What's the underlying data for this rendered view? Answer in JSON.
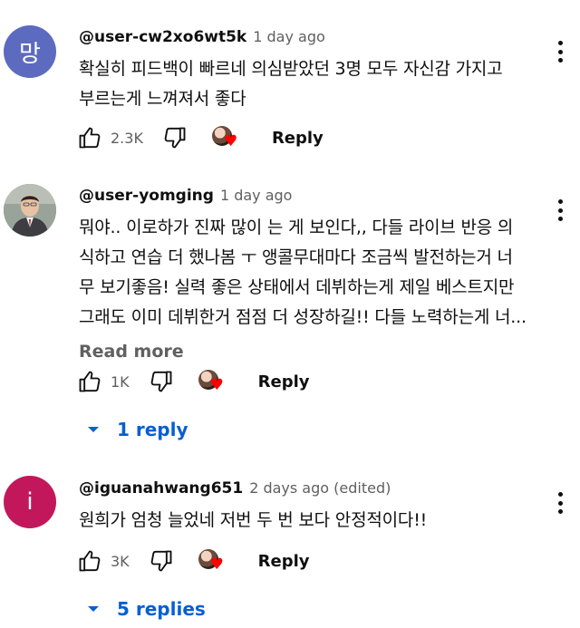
{
  "comments": [
    {
      "avatar_letter": "망",
      "avatar_color": "#5c6bc0",
      "handle": "@user-cw2xo6wt5k",
      "time": "1 day ago",
      "lines": [
        "확실히 피드백이 빠르네 의심받았던 3명 모두 자신감 가지고",
        "부르는게 느껴져서 좋다"
      ],
      "likes": "2.3K",
      "reply_label": "Reply"
    },
    {
      "avatar_letter": "",
      "avatar_color": "#8a8f86",
      "handle": "@user-yomging",
      "time": "1 day ago",
      "lines": [
        "뭐야.. 이로하가 진짜 많이 는 게 보인다,, 다들 라이브 반응 의",
        "식하고 연습 더 했나봄 ㅜ 앵콜무대마다 조금씩 발전하는거 너",
        "무 보기좋음! 실력 좋은 상태에서 데뷔하는게 제일 베스트지만",
        "그래도 이미 데뷔한거 점점 더 성장하길!! 다들 노력하는게 너..."
      ],
      "read_more": "Read more",
      "likes": "1K",
      "reply_label": "Reply",
      "replies_label": "1 reply"
    },
    {
      "avatar_letter": "i",
      "avatar_color": "#c2185b",
      "handle": "@iguanahwang651",
      "time": "2 days ago (edited)",
      "lines": [
        "원희가 엄청 늘었네 저번 두 번 보다 안정적이다!!"
      ],
      "likes": "3K",
      "reply_label": "Reply",
      "replies_label": "5 replies"
    }
  ],
  "icons": {
    "like": "thumbs-up-icon",
    "dislike": "thumbs-down-icon",
    "creator_heart": "creator-heart-icon",
    "more": "more-vert-icon",
    "expand": "chevron-down-icon"
  }
}
